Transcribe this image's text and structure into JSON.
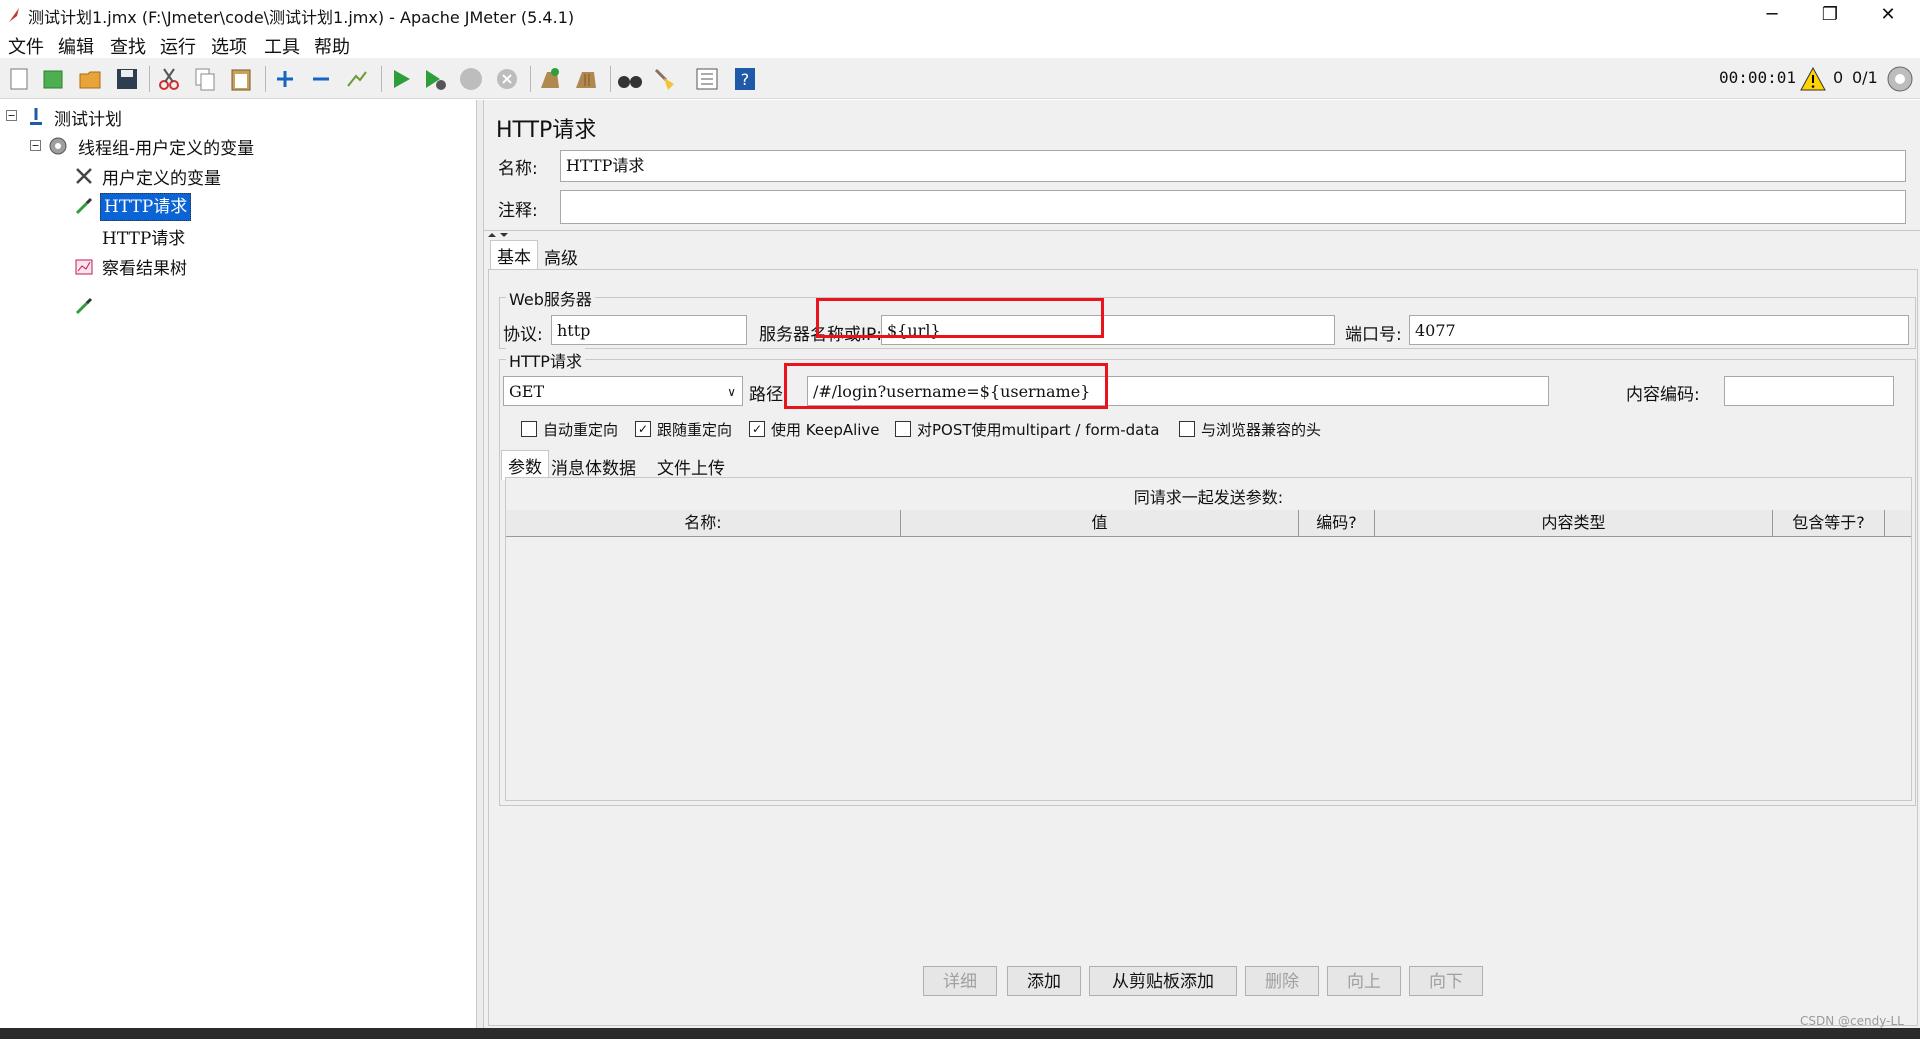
{
  "window": {
    "title": "测试计划1.jmx (F:\\Jmeter\\code\\测试计划1.jmx) - Apache JMeter (5.4.1)"
  },
  "menu": [
    "文件",
    "编辑",
    "查找",
    "运行",
    "选项",
    "工具",
    "帮助"
  ],
  "status": {
    "timer": "00:00:01",
    "warnings": "0",
    "threads": "0/1"
  },
  "tree": [
    {
      "label": "测试计划",
      "icon": "test-plan-icon"
    },
    {
      "label": "线程组-用户定义的变量",
      "icon": "thread-group-gear-icon"
    },
    {
      "label": "用户定义的变量",
      "icon": "config-tools-icon"
    },
    {
      "label": "HTTP请求",
      "icon": "sampler-pipette-icon",
      "selected": true
    },
    {
      "label": "HTTP请求",
      "icon": "sampler-pipette-icon"
    },
    {
      "label": "察看结果树",
      "icon": "listener-chart-icon"
    }
  ],
  "panel": {
    "heading": "HTTP请求",
    "name_label": "名称:",
    "name_value": "HTTP请求",
    "comment_label": "注释:",
    "comment_value": "",
    "tabs": [
      "基本",
      "高级"
    ]
  },
  "web_server": {
    "group_title": "Web服务器",
    "protocol_label": "协议:",
    "protocol_value": "http",
    "server_label": "服务器名称或IP:",
    "server_value": "${url}",
    "port_label": "端口号:",
    "port_value": "4077"
  },
  "http_request": {
    "group_title": "HTTP请求",
    "method": "GET",
    "path_label": "路径:",
    "path_value": "/#/login?username=${username}",
    "encoding_label": "内容编码:",
    "encoding_value": ""
  },
  "options": [
    {
      "label": "自动重定向",
      "checked": false
    },
    {
      "label": "跟随重定向",
      "checked": true
    },
    {
      "label": "使用 KeepAlive",
      "checked": true
    },
    {
      "label": "对POST使用multipart / form-data",
      "checked": false
    },
    {
      "label": "与浏览器兼容的头",
      "checked": false
    }
  ],
  "subtabs": [
    "参数",
    "消息体数据",
    "文件上传"
  ],
  "params": {
    "caption": "同请求一起发送参数:",
    "columns": [
      "名称:",
      "值",
      "编码?",
      "内容类型",
      "包含等于?"
    ]
  },
  "buttons": [
    {
      "label": "详细",
      "enabled": false
    },
    {
      "label": "添加",
      "enabled": true
    },
    {
      "label": "从剪贴板添加",
      "enabled": true
    },
    {
      "label": "删除",
      "enabled": false
    },
    {
      "label": "向上",
      "enabled": false
    },
    {
      "label": "向下",
      "enabled": false
    }
  ],
  "watermark": "CSDN @cendy-LL",
  "colors": {
    "highlight": "#e8131b",
    "selection": "#0a64d6"
  }
}
